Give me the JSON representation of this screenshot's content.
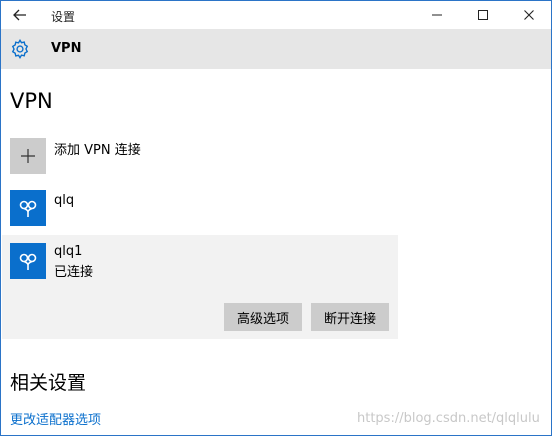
{
  "window": {
    "title": "设置"
  },
  "header": {
    "title": "VPN"
  },
  "page": {
    "title": "VPN"
  },
  "add_vpn": {
    "label": "添加 VPN 连接"
  },
  "connections": [
    {
      "name": "qlq",
      "status": ""
    },
    {
      "name": "qlq1",
      "status": "已连接"
    }
  ],
  "selected_actions": {
    "advanced_label": "高级选项",
    "disconnect_label": "断开连接"
  },
  "related": {
    "title": "相关设置",
    "adapter_link": "更改适配器选项"
  },
  "watermark": "https://blog.csdn.net/qlqlulu",
  "colors": {
    "accent": "#0a6fcc",
    "header_bg": "#e6e6e6",
    "selected_bg": "#f2f2f2",
    "button_bg": "#cccccc"
  },
  "icons": [
    "back-arrow-icon",
    "minimize-icon",
    "maximize-icon",
    "close-icon",
    "gear-icon",
    "plus-icon",
    "vpn-icon"
  ]
}
